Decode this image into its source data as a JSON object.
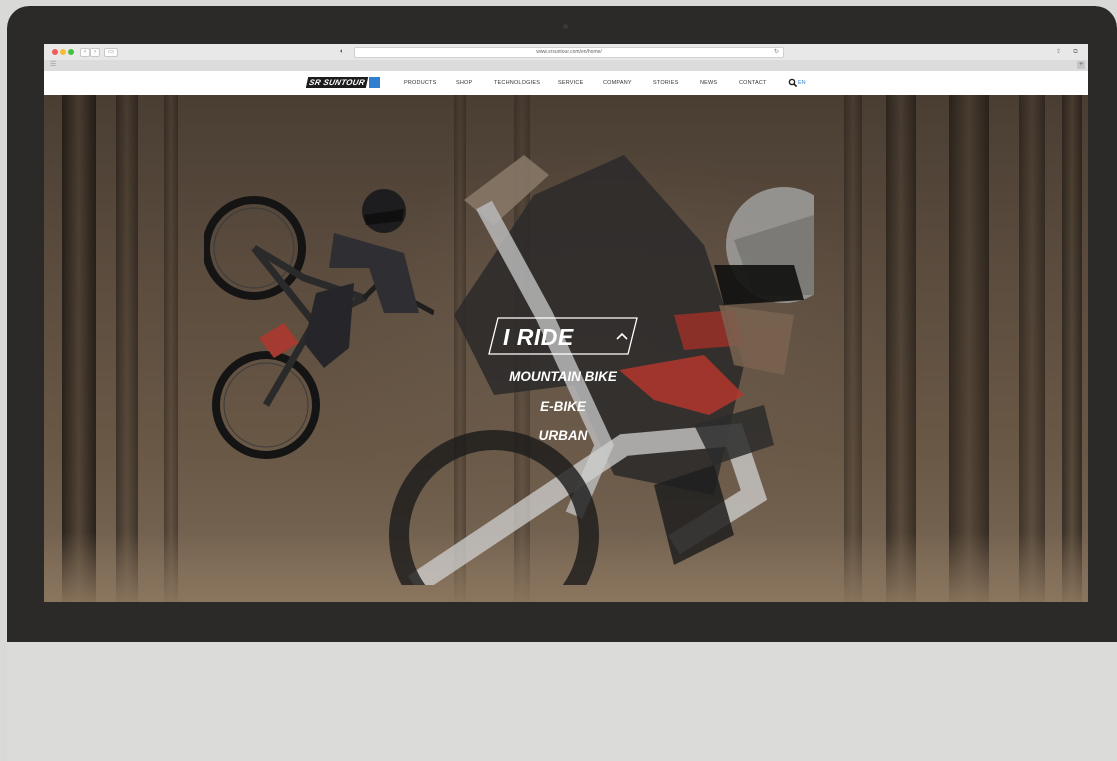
{
  "browser": {
    "url": "www.srsuntour.com/en/home/",
    "back_icon": "chevron-left-icon",
    "forward_icon": "chevron-right-icon"
  },
  "site": {
    "logo_text": "SR SUNTOUR",
    "accent_color": "#2f7fd0",
    "menu": [
      "PRODUCTS",
      "SHOP",
      "TECHNOLOGIES",
      "SERVICE",
      "COMPANY",
      "STORIES",
      "NEWS",
      "CONTACT"
    ],
    "language": "EN"
  },
  "hero": {
    "selector_label": "I RIDE",
    "options": [
      "MOUNTAIN BIKE",
      "E-BIKE",
      "URBAN"
    ]
  }
}
